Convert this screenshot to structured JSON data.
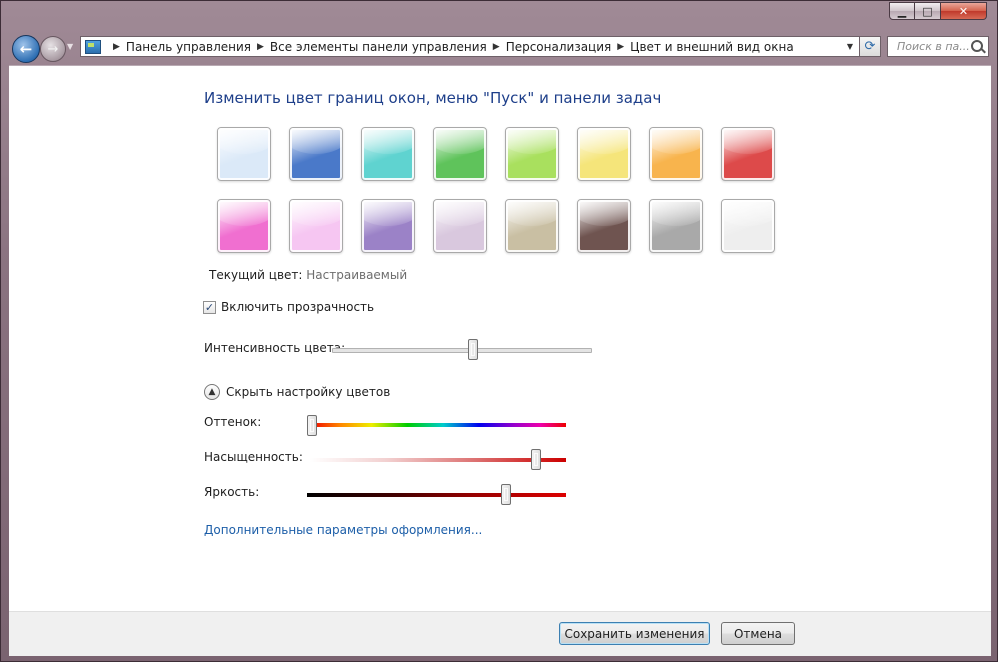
{
  "window": {
    "caption": {
      "minimize_glyph": "▁",
      "maximize_glyph": "□",
      "close_glyph": "✕"
    }
  },
  "nav": {
    "back_glyph": "←",
    "forward_glyph": "→",
    "breadcrumbs": [
      "Панель управления",
      "Все элементы панели управления",
      "Персонализация",
      "Цвет и внешний вид окна"
    ],
    "search_placeholder": "Поиск в па..."
  },
  "page": {
    "title": "Изменить цвет границ окон, меню \"Пуск\" и панели задач",
    "swatches": [
      {
        "name": "sky",
        "color": "#dbe9f8"
      },
      {
        "name": "twilight",
        "color": "#4a79c9"
      },
      {
        "name": "sea",
        "color": "#5fd3d0"
      },
      {
        "name": "leaf",
        "color": "#5fc35b"
      },
      {
        "name": "lime",
        "color": "#a9e05e"
      },
      {
        "name": "sun",
        "color": "#f5e57a"
      },
      {
        "name": "pumpkin",
        "color": "#f8b44d"
      },
      {
        "name": "ruby",
        "color": "#dd4a4a"
      },
      {
        "name": "fuchsia",
        "color": "#f06fd0"
      },
      {
        "name": "blush",
        "color": "#f6c6f2"
      },
      {
        "name": "violet",
        "color": "#9b82c7"
      },
      {
        "name": "lavender",
        "color": "#d9c8de"
      },
      {
        "name": "taupe",
        "color": "#c9bfa3"
      },
      {
        "name": "chocolate",
        "color": "#6f5450"
      },
      {
        "name": "slate",
        "color": "#a9a9a9"
      },
      {
        "name": "frost",
        "color": "#eeeeee"
      }
    ],
    "current_color_label": "Текущий цвет:",
    "current_color_value": "Настраиваемый",
    "transparency_label": "Включить прозрачность",
    "transparency_checked": true,
    "intensity_label": "Интенсивность цвета:",
    "intensity_value": 0.55,
    "mixer_toggle_label": "Скрыть настройку цветов",
    "hue_label": "Оттенок:",
    "hue_value": 0.0,
    "saturation_label": "Насыщенность:",
    "saturation_value": 0.9,
    "brightness_label": "Яркость:",
    "brightness_value": 0.78,
    "advanced_link": "Дополнительные параметры оформления..."
  },
  "footer": {
    "save_label": "Сохранить изменения",
    "cancel_label": "Отмена"
  }
}
